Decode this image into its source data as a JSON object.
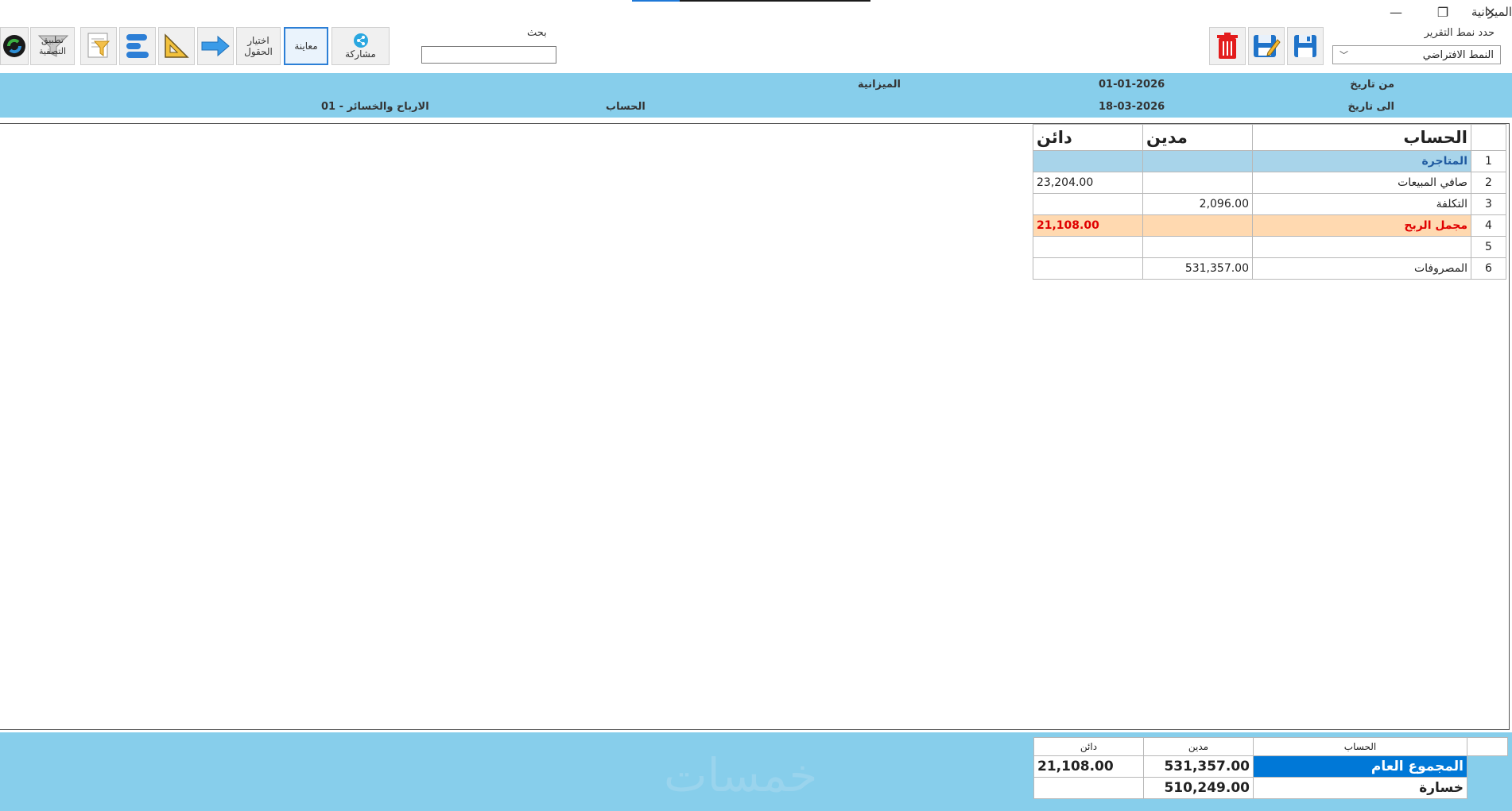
{
  "window": {
    "title": "الميزانية",
    "minimize": "—",
    "restore": "❐",
    "close": "✕"
  },
  "toolbar": {
    "apply_filter": "تطبيق التصفية",
    "select_fields_1": "اختيار",
    "select_fields_2": "الحقول",
    "preview": "معاينة",
    "share": "مشاركة",
    "search_label": "بحث",
    "search_value": "",
    "report_pattern_label": "حدد نمط التقرير",
    "report_pattern_value": "النمط الافتراضي"
  },
  "info": {
    "from_label": "من تاريخ",
    "from_value": "01-01-2026",
    "to_label": "الى تاريخ",
    "to_value": "18-03-2026",
    "report_name": "الميزانية",
    "account_label": "الحساب",
    "account_value": "01 - الارباح والخسائر"
  },
  "table": {
    "headers": {
      "account": "الحساب",
      "debit": "مدين",
      "credit": "دائن"
    },
    "rows": [
      {
        "idx": "1",
        "account": "المتاجرة",
        "debit": "",
        "credit": ""
      },
      {
        "idx": "2",
        "account": "صافي المبيعات",
        "debit": "",
        "credit": "23,204.00"
      },
      {
        "idx": "3",
        "account": "التكلفة",
        "debit": "2,096.00",
        "credit": ""
      },
      {
        "idx": "4",
        "account": "مجمل الربح",
        "debit": "",
        "credit": "21,108.00"
      },
      {
        "idx": "5",
        "account": "",
        "debit": "",
        "credit": ""
      },
      {
        "idx": "6",
        "account": "المصروفات",
        "debit": "531,357.00",
        "credit": ""
      }
    ]
  },
  "totals": {
    "headers": {
      "account": "الحساب",
      "debit": "مدين",
      "credit": "دائن"
    },
    "grand_total_label": "المجموع العام",
    "grand_total_debit": "531,357.00",
    "grand_total_credit": "21,108.00",
    "loss_label": "خسارة",
    "loss_debit": "510,249.00",
    "loss_credit": ""
  },
  "watermark": "خمسات",
  "colors": {
    "band": "#87ceeb",
    "row_section": "#a8d4ea",
    "row_highlight": "#ffd9b0",
    "highlight_text": "#e00000",
    "grand_total_bg": "#0078d7"
  }
}
